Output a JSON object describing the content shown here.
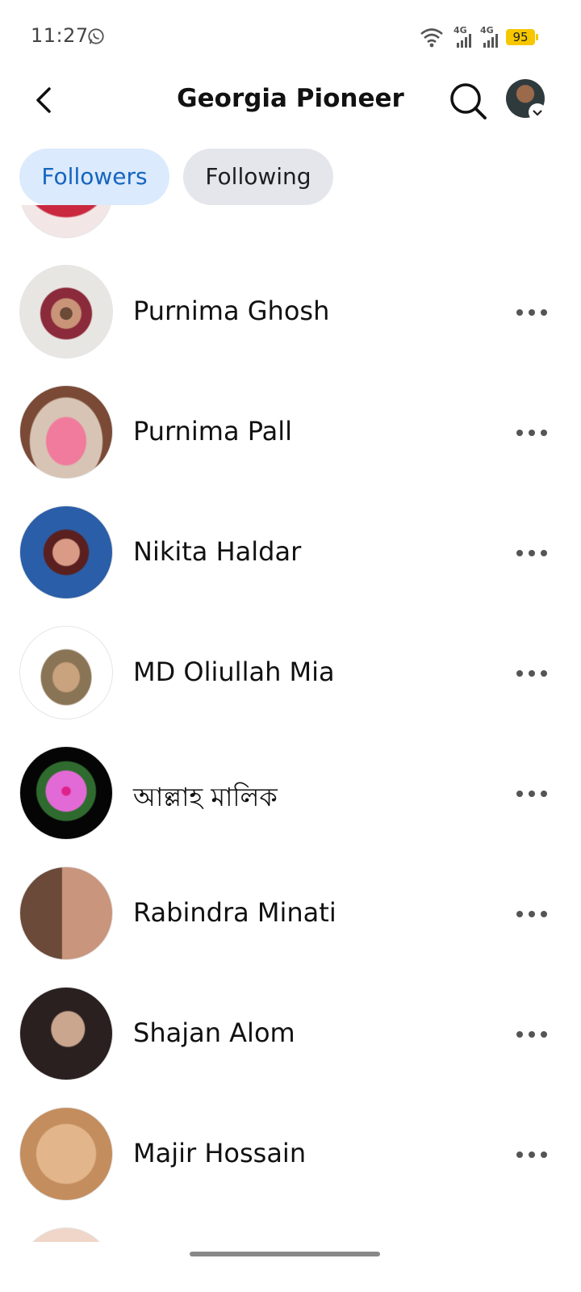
{
  "status_bar": {
    "time": "11:27",
    "network_1": "4G",
    "network_2": "4G",
    "battery": "95"
  },
  "header": {
    "title": "Georgia Pioneer"
  },
  "tabs": {
    "followers": "Followers",
    "following": "Following"
  },
  "followers": [
    {
      "name": "Purnima Ghosh"
    },
    {
      "name": "Purnima Pall"
    },
    {
      "name": "Nikita Haldar"
    },
    {
      "name": "MD Oliullah Mia"
    },
    {
      "name": "আল্লাহ মালিক"
    },
    {
      "name": "Rabindra Minati"
    },
    {
      "name": "Shajan Alom"
    },
    {
      "name": "Majir Hossain"
    }
  ],
  "colors": {
    "accent": "#1565c0",
    "selected_tab_bg": "#dbeafc",
    "tab_bg": "#e4e6eb",
    "battery": "#f6c700"
  }
}
